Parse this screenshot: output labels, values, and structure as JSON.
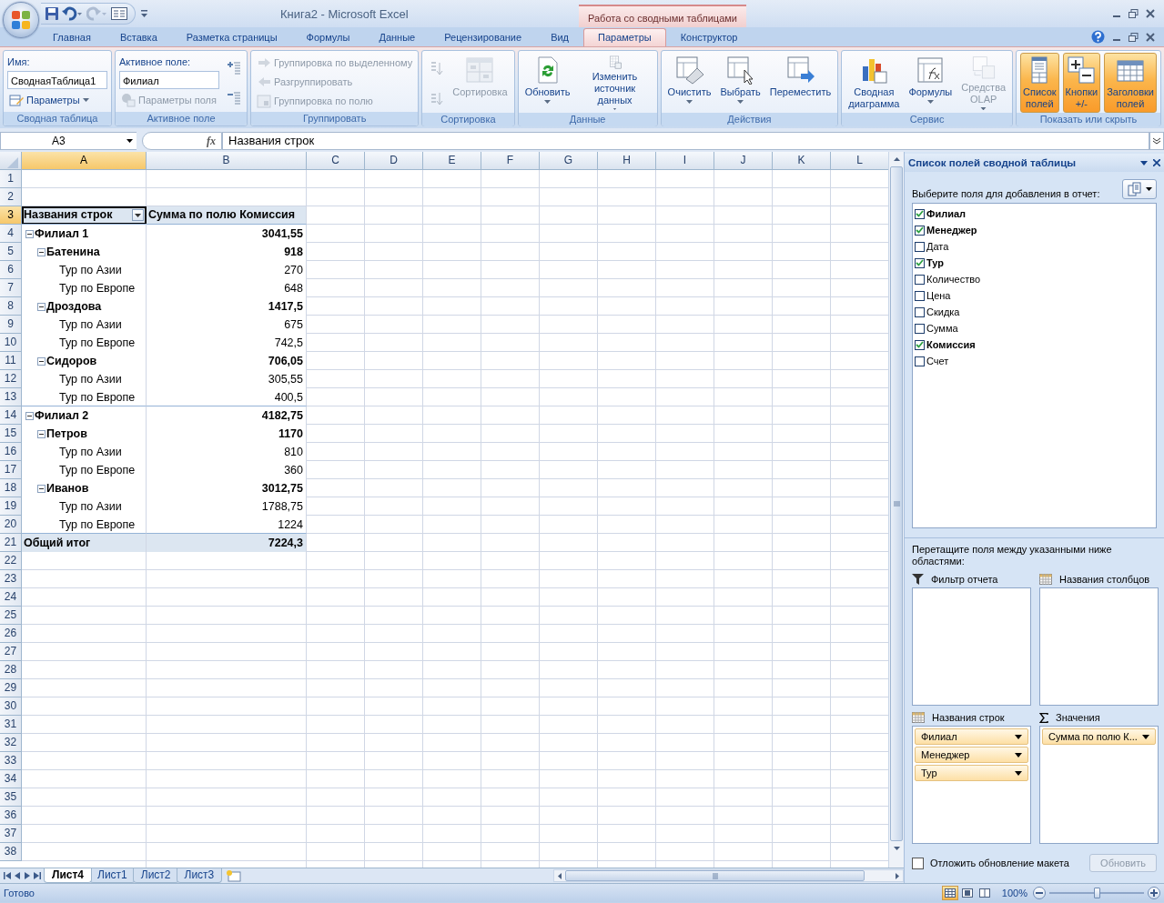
{
  "window": {
    "title": "Книга2 - Microsoft Excel",
    "context_group": "Работа со сводными таблицами"
  },
  "tabs": [
    {
      "label": "Главная",
      "selected": false
    },
    {
      "label": "Вставка",
      "selected": false
    },
    {
      "label": "Разметка страницы",
      "selected": false
    },
    {
      "label": "Формулы",
      "selected": false
    },
    {
      "label": "Данные",
      "selected": false
    },
    {
      "label": "Рецензирование",
      "selected": false
    },
    {
      "label": "Вид",
      "selected": false
    },
    {
      "label": "Параметры",
      "selected": true
    },
    {
      "label": "Конструктор",
      "selected": false
    }
  ],
  "ribbon": [
    {
      "label": "Сводная таблица",
      "columns": [
        [
          {
            "kind": "caption",
            "label": "Имя:"
          },
          {
            "kind": "field",
            "value": "СводнаяТаблица1"
          },
          {
            "kind": "small",
            "label": "Параметры",
            "has_menu": true,
            "disabled": false
          }
        ]
      ]
    },
    {
      "label": "Активное поле",
      "columns": [
        [
          {
            "kind": "caption",
            "label": "Активное поле:"
          },
          {
            "kind": "field",
            "value": "Филиал"
          },
          {
            "kind": "small",
            "label": "Параметры поля",
            "has_menu": false,
            "disabled": true
          }
        ],
        [
          {
            "kind": "icon",
            "disabled": false
          },
          {
            "kind": "icon",
            "disabled": false
          }
        ]
      ]
    },
    {
      "label": "Группировать",
      "columns": [
        [
          {
            "kind": "small",
            "label": "Группировка по выделенному",
            "has_menu": false,
            "disabled": true
          },
          {
            "kind": "small",
            "label": "Разгруппировать",
            "has_menu": false,
            "disabled": true
          },
          {
            "kind": "small",
            "label": "Группировка по полю",
            "has_menu": false,
            "disabled": true
          }
        ]
      ]
    },
    {
      "label": "Сортировка",
      "columns": [
        [
          {
            "kind": "icon",
            "disabled": true
          },
          {
            "kind": "icon",
            "disabled": true
          }
        ],
        [
          {
            "kind": "large",
            "label": "Сортировка",
            "has_menu": false,
            "disabled": true,
            "on": false
          }
        ]
      ]
    },
    {
      "label": "Данные",
      "columns": [
        [
          {
            "kind": "large",
            "label": "Обновить",
            "has_menu": true,
            "disabled": false,
            "on": false
          }
        ],
        [
          {
            "kind": "large",
            "label": "Изменить\nисточник данных",
            "has_menu": true,
            "disabled": false,
            "on": false
          }
        ]
      ]
    },
    {
      "label": "Действия",
      "columns": [
        [
          {
            "kind": "large",
            "label": "Очистить",
            "has_menu": true,
            "disabled": false,
            "on": false
          }
        ],
        [
          {
            "kind": "large",
            "label": "Выбрать",
            "has_menu": true,
            "disabled": false,
            "on": false
          }
        ],
        [
          {
            "kind": "large",
            "label": "Переместить",
            "has_menu": false,
            "disabled": false,
            "on": false
          }
        ]
      ]
    },
    {
      "label": "Сервис",
      "columns": [
        [
          {
            "kind": "large",
            "label": "Сводная\nдиаграмма",
            "has_menu": false,
            "disabled": false,
            "on": false
          }
        ],
        [
          {
            "kind": "large",
            "label": "Формулы",
            "has_menu": true,
            "disabled": false,
            "on": false
          }
        ],
        [
          {
            "kind": "large",
            "label": "Средства\nOLAP",
            "has_menu": true,
            "disabled": true,
            "on": false
          }
        ]
      ]
    },
    {
      "label": "Показать или скрыть",
      "columns": [
        [
          {
            "kind": "large",
            "label": "Список\nполей",
            "has_menu": false,
            "disabled": false,
            "on": true
          }
        ],
        [
          {
            "kind": "large",
            "label": "Кнопки\n+/-",
            "has_menu": false,
            "disabled": false,
            "on": true
          }
        ],
        [
          {
            "kind": "large",
            "label": "Заголовки\nполей",
            "has_menu": false,
            "disabled": false,
            "on": true
          }
        ]
      ]
    }
  ],
  "formula_bar": {
    "name_box": "A3",
    "function_button": "fx",
    "value": "Названия строк"
  },
  "columns": [
    {
      "label": "A",
      "selected": true
    },
    {
      "label": "B",
      "selected": false
    },
    {
      "label": "C",
      "selected": false
    },
    {
      "label": "D",
      "selected": false
    },
    {
      "label": "E",
      "selected": false
    },
    {
      "label": "F",
      "selected": false
    },
    {
      "label": "G",
      "selected": false
    },
    {
      "label": "H",
      "selected": false
    },
    {
      "label": "I",
      "selected": false
    },
    {
      "label": "J",
      "selected": false
    },
    {
      "label": "K",
      "selected": false
    },
    {
      "label": "L",
      "selected": false
    }
  ],
  "row_numbers": [
    {
      "label": "1",
      "selected": false
    },
    {
      "label": "2",
      "selected": false
    },
    {
      "label": "3",
      "selected": true
    },
    {
      "label": "4",
      "selected": false
    },
    {
      "label": "5",
      "selected": false
    },
    {
      "label": "6",
      "selected": false
    },
    {
      "label": "7",
      "selected": false
    },
    {
      "label": "8",
      "selected": false
    },
    {
      "label": "9",
      "selected": false
    },
    {
      "label": "10",
      "selected": false
    },
    {
      "label": "11",
      "selected": false
    },
    {
      "label": "12",
      "selected": false
    },
    {
      "label": "13",
      "selected": false
    },
    {
      "label": "14",
      "selected": false
    },
    {
      "label": "15",
      "selected": false
    },
    {
      "label": "16",
      "selected": false
    },
    {
      "label": "17",
      "selected": false
    },
    {
      "label": "18",
      "selected": false
    },
    {
      "label": "19",
      "selected": false
    },
    {
      "label": "20",
      "selected": false
    },
    {
      "label": "21",
      "selected": false
    },
    {
      "label": "22",
      "selected": false
    },
    {
      "label": "23",
      "selected": false
    },
    {
      "label": "24",
      "selected": false
    },
    {
      "label": "25",
      "selected": false
    },
    {
      "label": "26",
      "selected": false
    },
    {
      "label": "27",
      "selected": false
    },
    {
      "label": "28",
      "selected": false
    },
    {
      "label": "29",
      "selected": false
    },
    {
      "label": "30",
      "selected": false
    },
    {
      "label": "31",
      "selected": false
    },
    {
      "label": "32",
      "selected": false
    },
    {
      "label": "33",
      "selected": false
    },
    {
      "label": "34",
      "selected": false
    },
    {
      "label": "35",
      "selected": false
    },
    {
      "label": "36",
      "selected": false
    },
    {
      "label": "37",
      "selected": false
    },
    {
      "label": "38",
      "selected": false
    }
  ],
  "pivot": {
    "row_header": "Названия строк",
    "value_header": "Сумма по полю Комиссия",
    "rows": [
      {
        "label": "Филиал 1",
        "value": "3041,55",
        "expanded": true,
        "children": [
          {
            "label": "Батенина",
            "value": "918",
            "expanded": true,
            "children": [
              {
                "label": "Тур по Азии",
                "value": "270"
              },
              {
                "label": "Тур по Европе",
                "value": "648"
              }
            ]
          },
          {
            "label": "Дроздова",
            "value": "1417,5",
            "expanded": true,
            "children": [
              {
                "label": "Тур по Азии",
                "value": "675"
              },
              {
                "label": "Тур по Европе",
                "value": "742,5"
              }
            ]
          },
          {
            "label": "Сидоров",
            "value": "706,05",
            "expanded": true,
            "children": [
              {
                "label": "Тур по Азии",
                "value": "305,55"
              },
              {
                "label": "Тур по Европе",
                "value": "400,5"
              }
            ]
          }
        ]
      },
      {
        "label": "Филиал 2",
        "value": "4182,75",
        "expanded": true,
        "children": [
          {
            "label": "Петров",
            "value": "1170",
            "expanded": true,
            "children": [
              {
                "label": "Тур по Азии",
                "value": "810"
              },
              {
                "label": "Тур по Европе",
                "value": "360"
              }
            ]
          },
          {
            "label": "Иванов",
            "value": "3012,75",
            "expanded": true,
            "children": [
              {
                "label": "Тур по Азии",
                "value": "1788,75"
              },
              {
                "label": "Тур по Европе",
                "value": "1224"
              }
            ]
          }
        ]
      }
    ],
    "total_label": "Общий итог",
    "total_value": "7224,3"
  },
  "sheet_tabs": [
    {
      "label": "Лист4",
      "selected": true
    },
    {
      "label": "Лист1",
      "selected": false
    },
    {
      "label": "Лист2",
      "selected": false
    },
    {
      "label": "Лист3",
      "selected": false
    }
  ],
  "field_list": {
    "title": "Список полей сводной таблицы",
    "prompt": "Выберите поля для добавления в отчет:",
    "fields": [
      {
        "label": "Филиал",
        "checked": true
      },
      {
        "label": "Менеджер",
        "checked": true
      },
      {
        "label": "Дата",
        "checked": false
      },
      {
        "label": "Тур",
        "checked": true
      },
      {
        "label": "Количество",
        "checked": false
      },
      {
        "label": "Цена",
        "checked": false
      },
      {
        "label": "Скидка",
        "checked": false
      },
      {
        "label": "Сумма",
        "checked": false
      },
      {
        "label": "Комиссия",
        "checked": true
      },
      {
        "label": "Счет",
        "checked": false
      }
    ],
    "drag_hint": "Перетащите поля между указанными ниже областями:",
    "areas": [
      {
        "label": "Фильтр отчета"
      },
      {
        "label": "Названия столбцов"
      },
      {
        "label": "Названия строк",
        "items": [
          "Филиал",
          "Менеджер",
          "Тур"
        ]
      },
      {
        "label": "Значения",
        "items": [
          "Сумма по полю К..."
        ]
      }
    ],
    "defer_update": {
      "label": "Отложить обновление макета",
      "checked": false
    },
    "update_button": {
      "label": "Обновить",
      "disabled": true
    }
  },
  "status_bar": {
    "status": "Готово",
    "zoom": "100%",
    "zoom_slider": {
      "level": 0.5
    },
    "views": [
      {
        "selected": true
      },
      {
        "selected": false
      },
      {
        "selected": false
      }
    ]
  }
}
